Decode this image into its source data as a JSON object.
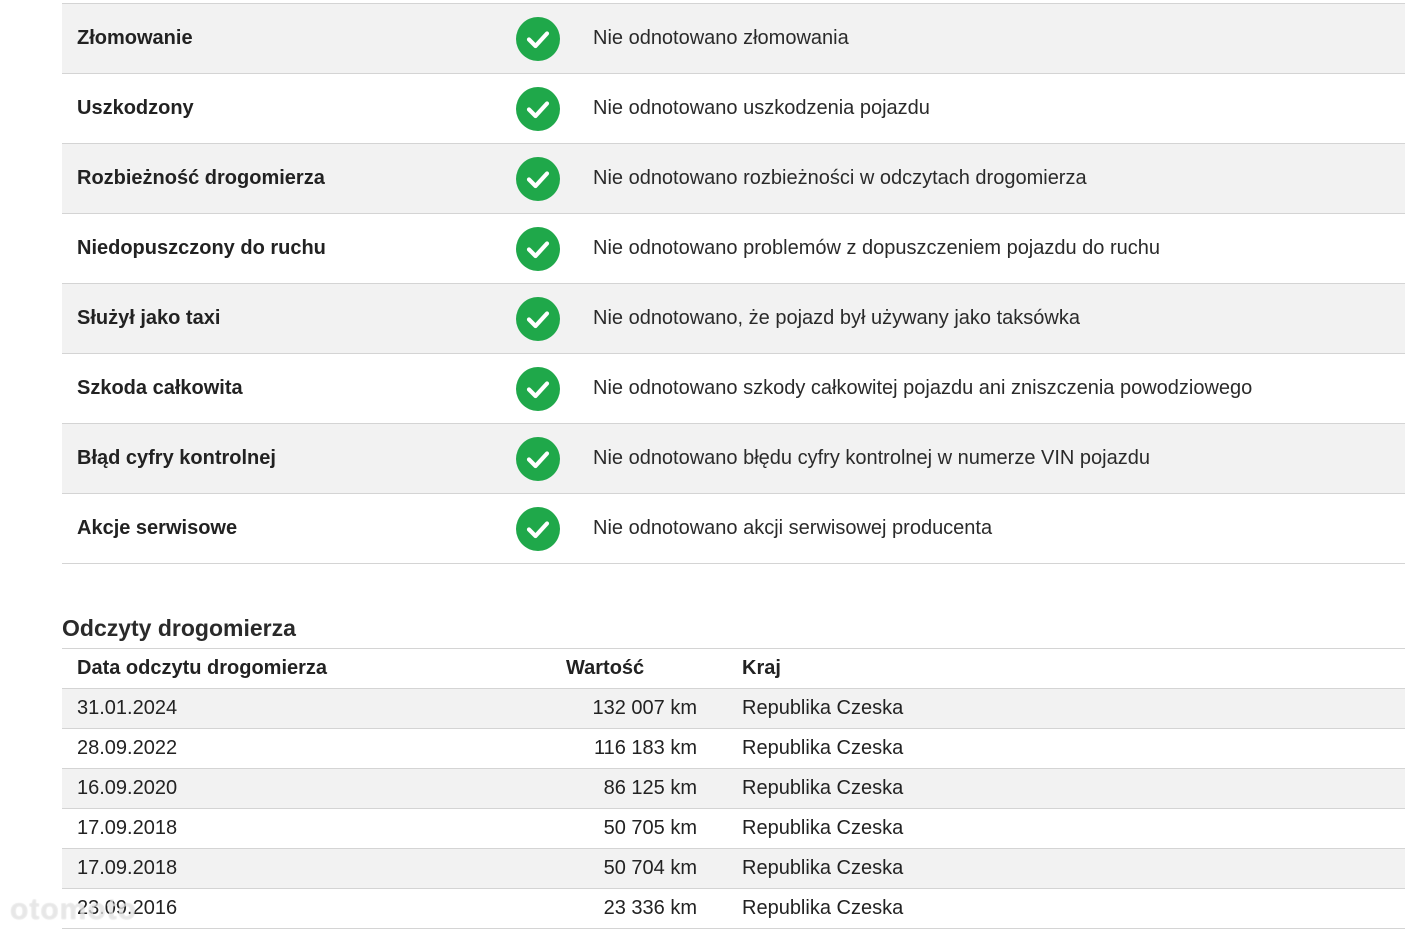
{
  "checks": [
    {
      "label": "Złomowanie",
      "description": "Nie odnotowano złomowania",
      "status": "ok"
    },
    {
      "label": "Uszkodzony",
      "description": "Nie odnotowano uszkodzenia pojazdu",
      "status": "ok"
    },
    {
      "label": "Rozbieżność drogomierza",
      "description": "Nie odnotowano rozbieżności w odczytach drogomierza",
      "status": "ok"
    },
    {
      "label": "Niedopuszczony do ruchu",
      "description": "Nie odnotowano problemów z dopuszczeniem pojazdu do ruchu",
      "status": "ok"
    },
    {
      "label": "Służył jako taxi",
      "description": "Nie odnotowano, że pojazd był używany jako taksówka",
      "status": "ok"
    },
    {
      "label": "Szkoda całkowita",
      "description": "Nie odnotowano szkody całkowitej pojazdu ani zniszczenia powodziowego",
      "status": "ok"
    },
    {
      "label": "Błąd cyfry kontrolnej",
      "description": "Nie odnotowano błędu cyfry kontrolnej w numerze VIN pojazdu",
      "status": "ok"
    },
    {
      "label": "Akcje serwisowe",
      "description": "Nie odnotowano akcji serwisowej producenta",
      "status": "ok"
    }
  ],
  "check_icon": "check-circle-icon",
  "check_color": "#1fa84a",
  "odometer": {
    "title": "Odczyty drogomierza",
    "headers": {
      "date": "Data odczytu drogomierza",
      "value": "Wartość",
      "country": "Kraj"
    },
    "rows": [
      {
        "date": "31.01.2024",
        "value": "132 007 km",
        "country": "Republika Czeska"
      },
      {
        "date": "28.09.2022",
        "value": "116 183 km",
        "country": "Republika Czeska"
      },
      {
        "date": "16.09.2020",
        "value": "86 125 km",
        "country": "Republika Czeska"
      },
      {
        "date": "17.09.2018",
        "value": "50 705 km",
        "country": "Republika Czeska"
      },
      {
        "date": "17.09.2018",
        "value": "50 704 km",
        "country": "Republika Czeska"
      },
      {
        "date": "23.09.2016",
        "value": "23 336 km",
        "country": "Republika Czeska"
      }
    ]
  },
  "watermark": "otomoto"
}
